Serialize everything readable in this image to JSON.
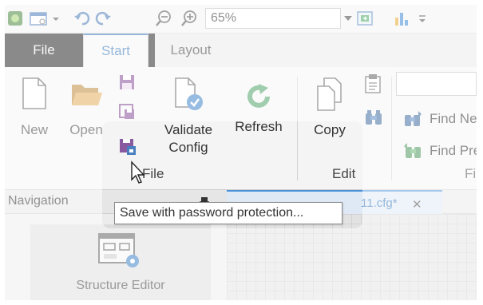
{
  "quick_access": {
    "zoom_value": "65%",
    "icons": [
      "app-icon",
      "new-window-icon",
      "undo-icon",
      "redo-icon",
      "zoom-out-icon",
      "zoom-in-icon",
      "fit-page-icon",
      "chart-icon",
      "customize-icon"
    ]
  },
  "menu": {
    "tabs": [
      {
        "label": "File",
        "active": false
      },
      {
        "label": "Start",
        "active": true
      },
      {
        "label": "Layout",
        "active": false
      }
    ]
  },
  "ribbon": {
    "file_group": {
      "label": "File",
      "new_label": "New",
      "open_label": "Open",
      "validate_label_line1": "Validate",
      "validate_label_line2": "Config",
      "refresh_label": "Refresh"
    },
    "edit_group": {
      "label": "Edit",
      "copy_label": "Copy"
    },
    "find_group": {
      "label": "Fi",
      "find_next_label": "Find Ne",
      "find_prev_label": "Find Pre"
    }
  },
  "navigation": {
    "title": "Navigation",
    "structure_editor_label": "Structure Editor"
  },
  "document": {
    "tab_title": "11.cfg*",
    "close_glyph": "✕"
  },
  "tooltip": {
    "text": "Save with password protection..."
  },
  "colors": {
    "accent": "#2b6fb7",
    "refresh_green": "#3f9a5a",
    "folder": "#d9a04a",
    "save_purple": "#7b3f8f"
  }
}
